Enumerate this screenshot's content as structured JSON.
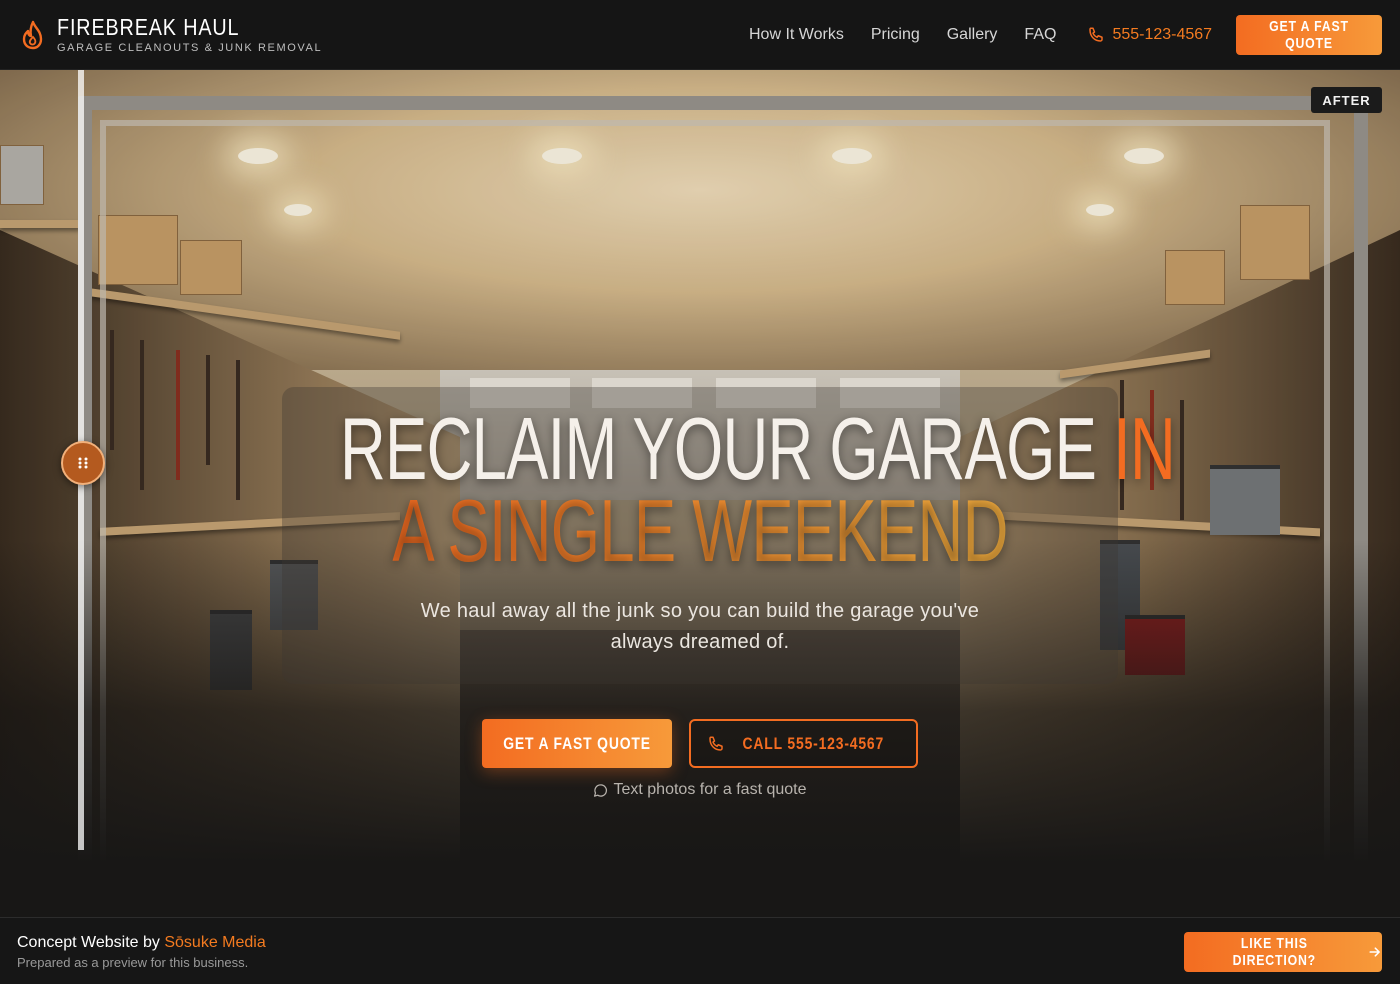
{
  "brand": {
    "name": "FIREBREAK HAUL",
    "tagline": "GARAGE CLEANOUTS & JUNK REMOVAL",
    "icon": "flame-icon",
    "accent_color": "#f36c21"
  },
  "nav": {
    "links": [
      {
        "label": "How It Works"
      },
      {
        "label": "Pricing"
      },
      {
        "label": "Gallery"
      },
      {
        "label": "FAQ"
      }
    ],
    "phone": "555-123-4567",
    "cta_label": "GET A FAST QUOTE"
  },
  "hero": {
    "badge": "AFTER",
    "headline_part1": "RECLAIM YOUR GARAGE ",
    "headline_accent1": "IN",
    "headline_accent2": "A SINGLE WEEKEND",
    "subhead": "We haul away all the junk so you can build the garage you've always dreamed of.",
    "primary_cta": "GET A FAST QUOTE",
    "secondary_cta": "CALL 555-123-4567",
    "text_photos": "Text photos for a fast quote"
  },
  "footer": {
    "title_prefix": "Concept Website by ",
    "title_brand": "Sōsuke Media",
    "subtitle": "Prepared as a preview for this business.",
    "cta_label": "LIKE THIS DIRECTION?"
  }
}
